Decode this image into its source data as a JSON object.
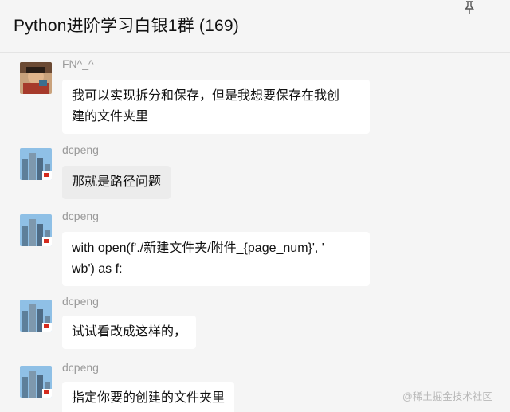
{
  "header": {
    "title": "Python进阶学习白银1群 (169)"
  },
  "icons": {
    "pin": "pin-icon",
    "avatar_fn": "avatar-photo-person",
    "avatar_dcpeng": "avatar-photo-buildings"
  },
  "colors": {
    "background": "#f5f5f5",
    "bubble": "#ffffff",
    "bubble_grey": "#ececec",
    "sender_name": "#9a9a9a"
  },
  "messages": [
    {
      "sender": "FN^_^",
      "line1": "我可以实现拆分和保存，但是我想要保存在我创",
      "line2": "建的文件夹里"
    },
    {
      "sender": "dcpeng",
      "line1": "那就是路径问题"
    },
    {
      "sender": "dcpeng",
      "line1": "with open(f'./新建文件夹/附件_{page_num}', '",
      "line2": "wb') as f:"
    },
    {
      "sender": "dcpeng",
      "line1": "试试看改成这样的，"
    },
    {
      "sender": "dcpeng",
      "line1": "指定你要的创建的文件夹里"
    }
  ],
  "watermark": "@稀土掘金技术社区"
}
